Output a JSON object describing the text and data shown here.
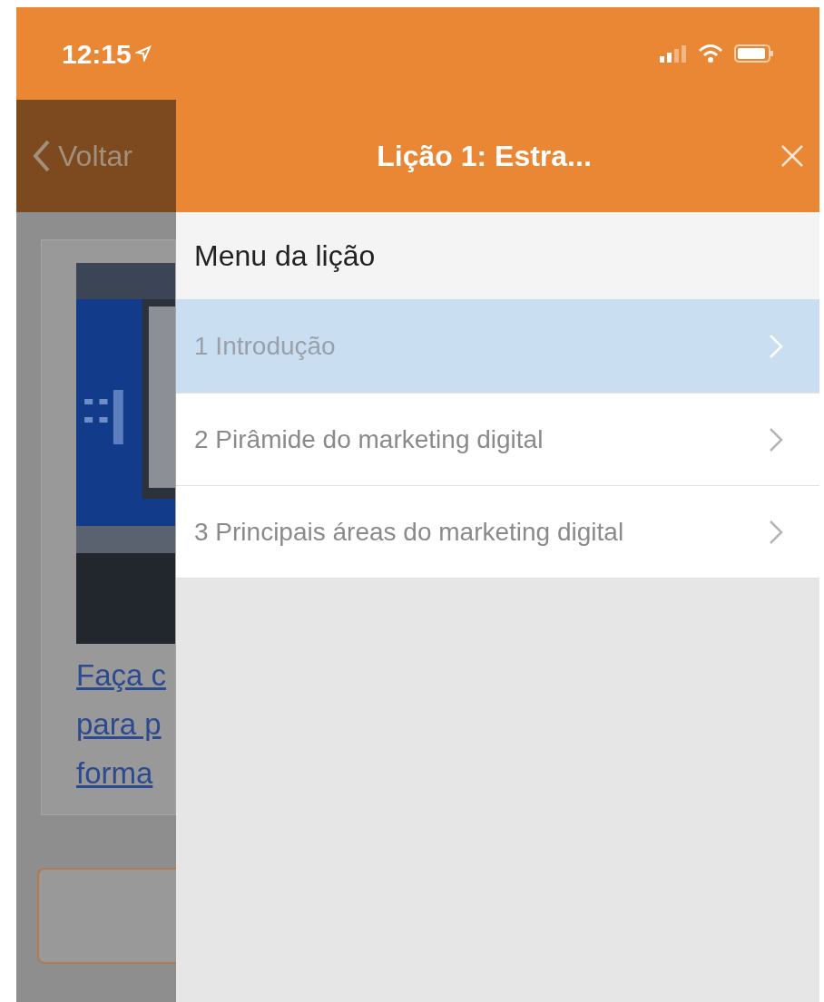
{
  "status_bar": {
    "time": "12:15"
  },
  "nav_bar": {
    "back_label": "Voltar",
    "title": "Lição 1: Estra..."
  },
  "background_card": {
    "link_lines": [
      "Faça c",
      "para p",
      "forma"
    ]
  },
  "drawer": {
    "heading": "Menu da lição",
    "items": [
      {
        "label": "1 Introdução",
        "selected": true
      },
      {
        "label": "2 Pirâmide do marketing digital",
        "selected": false
      },
      {
        "label": "3 Principais áreas do marketing digital",
        "selected": false
      }
    ]
  }
}
